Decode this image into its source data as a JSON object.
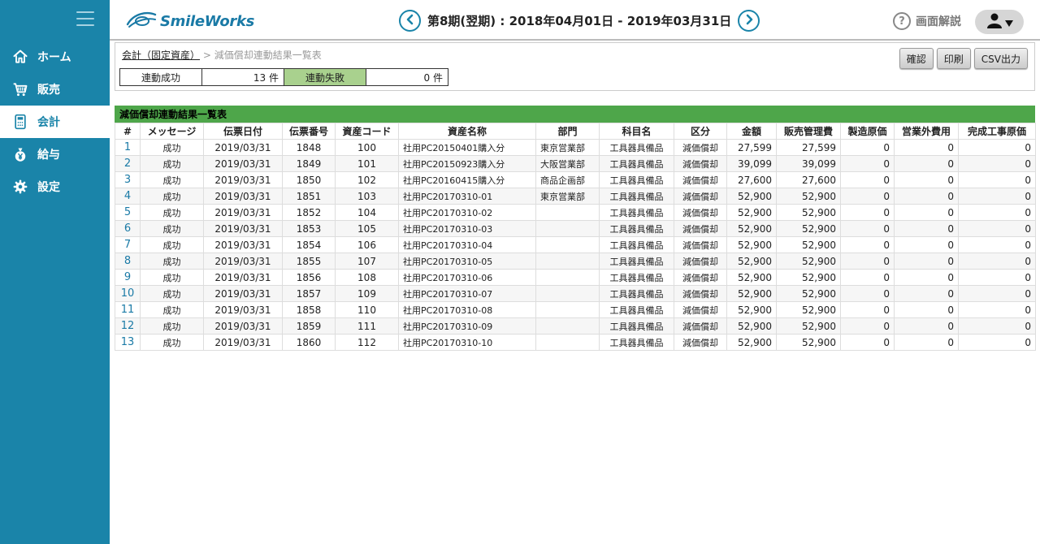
{
  "sidebar": {
    "items": [
      {
        "label": "ホーム",
        "icon": "home-icon"
      },
      {
        "label": "販売",
        "icon": "cart-icon"
      },
      {
        "label": "会計",
        "icon": "calculator-icon"
      },
      {
        "label": "給与",
        "icon": "yen-bag-icon"
      },
      {
        "label": "設定",
        "icon": "gear-icon"
      }
    ]
  },
  "header": {
    "logo": "SmileWorks",
    "period": "第8期(翌期) : 2018年04月01日 - 2019年03月31日",
    "help_label": "画面解説",
    "help_symbol": "?"
  },
  "breadcrumb": {
    "parent": "会計（固定資産）",
    "separator": " > ",
    "current": "減価償却連動結果一覧表"
  },
  "summary": {
    "success_label": "連動成功",
    "success_value": "13  件",
    "fail_label": "連動失敗",
    "fail_value": "0  件"
  },
  "actions": {
    "confirm": "確認",
    "print": "印刷",
    "csv": "CSV出力"
  },
  "table": {
    "title": "減価償却連動結果一覧表",
    "columns": [
      "#",
      "メッセージ",
      "伝票日付",
      "伝票番号",
      "資産コード",
      "資産名称",
      "部門",
      "科目名",
      "区分",
      "金額",
      "販売管理費",
      "製造原価",
      "営業外費用",
      "完成工事原価"
    ],
    "rows": [
      [
        "1",
        "成功",
        "2019/03/31",
        "1848",
        "100",
        "社用PC20150401購入分",
        "東京営業部",
        "工具器具備品",
        "減価償却",
        "27,599",
        "27,599",
        "0",
        "0",
        "0"
      ],
      [
        "2",
        "成功",
        "2019/03/31",
        "1849",
        "101",
        "社用PC20150923購入分",
        "大阪営業部",
        "工具器具備品",
        "減価償却",
        "39,099",
        "39,099",
        "0",
        "0",
        "0"
      ],
      [
        "3",
        "成功",
        "2019/03/31",
        "1850",
        "102",
        "社用PC20160415購入分",
        "商品企画部",
        "工具器具備品",
        "減価償却",
        "27,600",
        "27,600",
        "0",
        "0",
        "0"
      ],
      [
        "4",
        "成功",
        "2019/03/31",
        "1851",
        "103",
        "社用PC20170310-01",
        "東京営業部",
        "工具器具備品",
        "減価償却",
        "52,900",
        "52,900",
        "0",
        "0",
        "0"
      ],
      [
        "5",
        "成功",
        "2019/03/31",
        "1852",
        "104",
        "社用PC20170310-02",
        "",
        "工具器具備品",
        "減価償却",
        "52,900",
        "52,900",
        "0",
        "0",
        "0"
      ],
      [
        "6",
        "成功",
        "2019/03/31",
        "1853",
        "105",
        "社用PC20170310-03",
        "",
        "工具器具備品",
        "減価償却",
        "52,900",
        "52,900",
        "0",
        "0",
        "0"
      ],
      [
        "7",
        "成功",
        "2019/03/31",
        "1854",
        "106",
        "社用PC20170310-04",
        "",
        "工具器具備品",
        "減価償却",
        "52,900",
        "52,900",
        "0",
        "0",
        "0"
      ],
      [
        "8",
        "成功",
        "2019/03/31",
        "1855",
        "107",
        "社用PC20170310-05",
        "",
        "工具器具備品",
        "減価償却",
        "52,900",
        "52,900",
        "0",
        "0",
        "0"
      ],
      [
        "9",
        "成功",
        "2019/03/31",
        "1856",
        "108",
        "社用PC20170310-06",
        "",
        "工具器具備品",
        "減価償却",
        "52,900",
        "52,900",
        "0",
        "0",
        "0"
      ],
      [
        "10",
        "成功",
        "2019/03/31",
        "1857",
        "109",
        "社用PC20170310-07",
        "",
        "工具器具備品",
        "減価償却",
        "52,900",
        "52,900",
        "0",
        "0",
        "0"
      ],
      [
        "11",
        "成功",
        "2019/03/31",
        "1858",
        "110",
        "社用PC20170310-08",
        "",
        "工具器具備品",
        "減価償却",
        "52,900",
        "52,900",
        "0",
        "0",
        "0"
      ],
      [
        "12",
        "成功",
        "2019/03/31",
        "1859",
        "111",
        "社用PC20170310-09",
        "",
        "工具器具備品",
        "減価償却",
        "52,900",
        "52,900",
        "0",
        "0",
        "0"
      ],
      [
        "13",
        "成功",
        "2019/03/31",
        "1860",
        "112",
        "社用PC20170310-10",
        "",
        "工具器具備品",
        "減価償却",
        "52,900",
        "52,900",
        "0",
        "0",
        "0"
      ]
    ]
  },
  "colors": {
    "sidebar": "#1a84a9",
    "table_title": "#4ea64a",
    "fail_cell": "#a9d18e",
    "link": "#1a7aa6"
  }
}
